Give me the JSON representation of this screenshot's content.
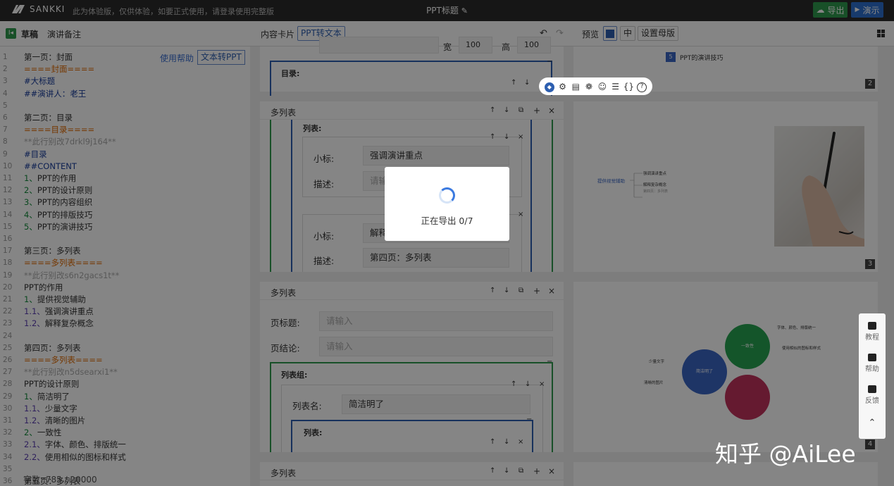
{
  "header": {
    "logo": "SANKKI",
    "notice": "此为体验版，仅供体验，如要正式使用，请登录使用完整版",
    "doc_title": "PPT标题",
    "export_label": "导出",
    "present_label": "演示"
  },
  "toolbar": {
    "tab_draft": "草稿",
    "tab_notes": "演讲备注",
    "content_card": "内容卡片",
    "ppt_to_text": "PPT转文本",
    "preview": "预览",
    "mid_label": "中",
    "master": "设置母版"
  },
  "editor": {
    "help": "使用帮助",
    "text_to_ppt": "文本转PPT",
    "word_count": "字数: 785 / 20000",
    "lines": [
      {
        "n": "1",
        "t": "第一页：封面",
        "c": "black"
      },
      {
        "n": "2",
        "t": "====封面====",
        "c": "orange"
      },
      {
        "n": "3",
        "t": "#大标题",
        "c": "blue"
      },
      {
        "n": "4",
        "t": "##演讲人：老王",
        "c": "blue"
      },
      {
        "n": "5",
        "t": "",
        "c": "black"
      },
      {
        "n": "6",
        "t": "第二页：目录",
        "c": "black"
      },
      {
        "n": "7",
        "t": "====目录====",
        "c": "orange"
      },
      {
        "n": "8",
        "t": "**此行别改7drkl9j164**",
        "c": "gray"
      },
      {
        "n": "9",
        "t": "#目录",
        "c": "blue"
      },
      {
        "n": "10",
        "t": "##CONTENT",
        "c": "blue"
      },
      {
        "n": "11",
        "t": "1、PPT的作用",
        "c": "blue"
      },
      {
        "n": "12",
        "t": "2、PPT的设计原则",
        "c": "blue"
      },
      {
        "n": "13",
        "t": "3、PPT的内容组织",
        "c": "blue"
      },
      {
        "n": "14",
        "t": "4、PPT的排版技巧",
        "c": "blue"
      },
      {
        "n": "15",
        "t": "5、PPT的演讲技巧",
        "c": "blue"
      },
      {
        "n": "16",
        "t": "",
        "c": "black"
      },
      {
        "n": "17",
        "t": "第三页：多列表",
        "c": "black"
      },
      {
        "n": "18",
        "t": "====多列表====",
        "c": "orange"
      },
      {
        "n": "19",
        "t": "**此行别改s6n2gacs1t**",
        "c": "gray"
      },
      {
        "n": "20",
        "t": "PPT的作用",
        "c": "black"
      },
      {
        "n": "21",
        "t": "1、提供视觉辅助",
        "c": "blue"
      },
      {
        "n": "22",
        "t": "1.1、强调演讲重点",
        "c": "blue"
      },
      {
        "n": "23",
        "t": "1.2、解释复杂概念",
        "c": "blue"
      },
      {
        "n": "24",
        "t": "",
        "c": "black"
      },
      {
        "n": "25",
        "t": "第四页：多列表",
        "c": "black"
      },
      {
        "n": "26",
        "t": "====多列表====",
        "c": "orange"
      },
      {
        "n": "27",
        "t": "**此行别改n5dsearxi1**",
        "c": "gray"
      },
      {
        "n": "28",
        "t": "PPT的设计原则",
        "c": "black"
      },
      {
        "n": "29",
        "t": "1、简洁明了",
        "c": "blue"
      },
      {
        "n": "30",
        "t": "1.1、少量文字",
        "c": "blue"
      },
      {
        "n": "31",
        "t": "1.2、清晰的图片",
        "c": "blue"
      },
      {
        "n": "32",
        "t": "2、一致性",
        "c": "blue"
      },
      {
        "n": "33",
        "t": "2.1、字体、颜色、排版统一",
        "c": "blue"
      },
      {
        "n": "34",
        "t": "2.2、使用相似的图标和样式",
        "c": "blue"
      },
      {
        "n": "35",
        "t": "",
        "c": "black"
      },
      {
        "n": "36",
        "t": "第五页：多列表",
        "c": "black"
      }
    ]
  },
  "cards": {
    "card1_wide": "宽",
    "card1_wide_val": "100",
    "card1_high": "高",
    "card1_high_val": "100",
    "card1_toc": "目录:",
    "card2_title": "多列表",
    "card2_list": "列表:",
    "card2_sub1_label": "小标:",
    "card2_sub1_value": "强调演讲重点",
    "card2_desc1_label": "描述:",
    "card2_desc1_value": "请输",
    "card2_sub2_label": "小标:",
    "card2_sub2_value": "解释",
    "card2_desc2_label": "描述:",
    "card2_desc2_value": "第四页：多列表",
    "card3_title": "多列表",
    "card3_page_title": "页标题:",
    "card3_page_title_ph": "请输入",
    "card3_page_end": "页结论:",
    "card3_page_end_ph": "请输入",
    "card3_group": "列表组:",
    "card3_list_name": "列表名:",
    "card3_list_name_val": "简洁明了",
    "card3_list": "列表:",
    "card4_title": "多列表"
  },
  "slides": {
    "slide2_num": "5",
    "slide2_text": "PPT的演讲技巧",
    "slide2_page": "2",
    "slide3_center": "提供视觉辅助",
    "slide3_b1": "强调演讲重点",
    "slide3_b2": "解释复杂概念",
    "slide3_b3": "第四页：多列表",
    "slide3_page": "3",
    "slide4_c1": "一致性",
    "slide4_c2": "简洁明了",
    "slide4_l1": "少量文字",
    "slide4_l2": "清晰的图片",
    "slide4_r1": "字体、颜色、排版统一",
    "slide4_r2": "使用相似的图标和样式",
    "slide4_page": "4"
  },
  "modal": {
    "text": "正在导出 0/7"
  },
  "side_panel": {
    "tutorial": "教程",
    "help": "帮助",
    "feedback": "反馈"
  },
  "watermark": "知乎 @AiLee",
  "colors": {
    "export_green": "#2f9a4d",
    "present_blue": "#2d6fd0",
    "accent_blue": "#2d5fb0"
  }
}
